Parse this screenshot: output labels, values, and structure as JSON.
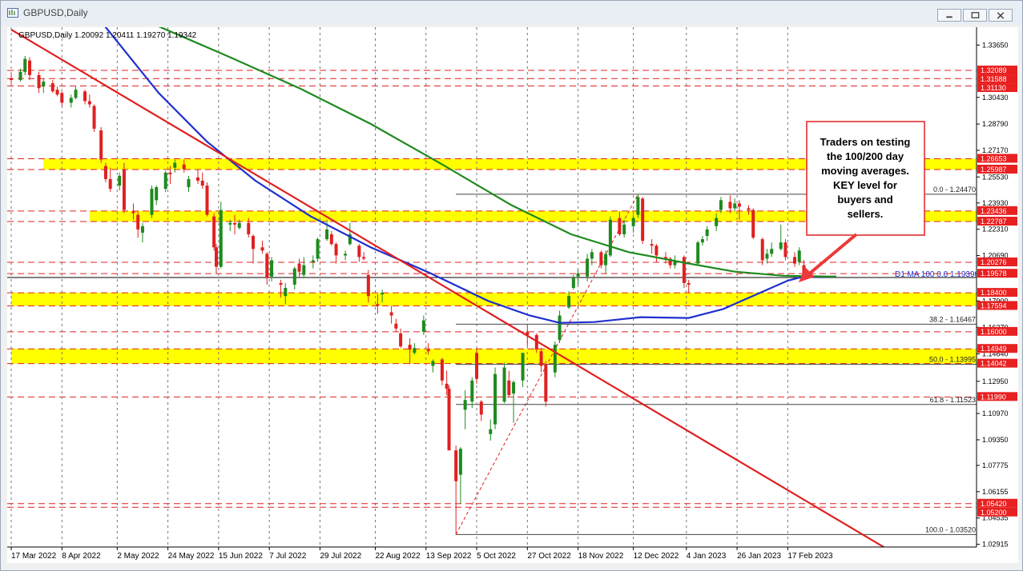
{
  "window": {
    "title": "GBPUSD,Daily",
    "buttons": [
      "minimize",
      "restore",
      "close"
    ]
  },
  "chart_data": {
    "type": "candlestick",
    "symbol_info": "GBPUSD,Daily  1.20092 1.20411 1.19270 1.19342",
    "symbol": "GBPUSD",
    "timeframe": "Daily",
    "ohlc_last": {
      "open": 1.20092,
      "high": 1.20411,
      "low": 1.1927,
      "close": 1.19342
    },
    "ylim": [
      1.0275,
      1.3475
    ],
    "y_ticks": [
      "1.33650",
      "1.30430",
      "1.28790",
      "1.27170",
      "1.25530",
      "1.23930",
      "1.22310",
      "1.20690",
      "1.19570",
      "1.17900",
      "1.16270",
      "1.14640",
      "1.12950",
      "1.10970",
      "1.09350",
      "1.07775",
      "1.06155",
      "1.04535",
      "1.02915"
    ],
    "x_dates": [
      "2022-03-17",
      "2023-02-28"
    ],
    "x_tick_labels": [
      {
        "label": "17 Mar 2022",
        "date": "2022-03-17"
      },
      {
        "label": "8 Apr 2022",
        "date": "2022-04-08"
      },
      {
        "label": "2 May 2022",
        "date": "2022-05-02"
      },
      {
        "label": "24 May 2022",
        "date": "2022-05-24"
      },
      {
        "label": "15 Jun 2022",
        "date": "2022-06-15"
      },
      {
        "label": "7 Jul 2022",
        "date": "2022-07-07"
      },
      {
        "label": "29 Jul 2022",
        "date": "2022-07-29"
      },
      {
        "label": "22 Aug 2022",
        "date": "2022-08-22"
      },
      {
        "label": "13 Sep 2022",
        "date": "2022-09-13"
      },
      {
        "label": "5 Oct 2022",
        "date": "2022-10-05"
      },
      {
        "label": "27 Oct 2022",
        "date": "2022-10-27"
      },
      {
        "label": "18 Nov 2022",
        "date": "2022-11-18"
      },
      {
        "label": "12 Dec 2022",
        "date": "2022-12-12"
      },
      {
        "label": "4 Jan 2023",
        "date": "2023-01-04"
      },
      {
        "label": "26 Jan 2023",
        "date": "2023-01-26"
      },
      {
        "label": "17 Feb 2023",
        "date": "2023-02-17"
      }
    ],
    "price_labels": [
      {
        "label": "1.32089",
        "value": 1.32089
      },
      {
        "label": "1.31588",
        "value": 1.31588
      },
      {
        "label": "1.31130",
        "value": 1.3113
      },
      {
        "label": "1.26653",
        "value": 1.26653
      },
      {
        "label": "1.25987",
        "value": 1.25987
      },
      {
        "label": "1.23436",
        "value": 1.23436
      },
      {
        "label": "1.22787",
        "value": 1.22787
      },
      {
        "label": "1.20276",
        "value": 1.20276
      },
      {
        "label": "1.19578",
        "value": 1.19578
      },
      {
        "label": "1.18400",
        "value": 1.184
      },
      {
        "label": "1.17594",
        "value": 1.17594
      },
      {
        "label": "1.16000",
        "value": 1.16
      },
      {
        "label": "1.14949",
        "value": 1.14949
      },
      {
        "label": "1.14042",
        "value": 1.14042
      },
      {
        "label": "1.11990",
        "value": 1.1199
      },
      {
        "label": "1.05420",
        "value": 1.0542
      },
      {
        "label": "1.05200",
        "value": 1.052
      }
    ],
    "yellow_zones": [
      {
        "from": 1.25987,
        "to": 1.26653,
        "x_start": "2022-03-31"
      },
      {
        "from": 1.22787,
        "to": 1.23436,
        "x_start": "2022-04-20"
      },
      {
        "from": 1.17594,
        "to": 1.184,
        "x_start": "2022-03-17"
      },
      {
        "from": 1.14042,
        "to": 1.14949,
        "x_start": "2022-03-17"
      }
    ],
    "red_dashed_levels": [
      1.32089,
      1.31588,
      1.3113,
      1.26653,
      1.25987,
      1.23436,
      1.22787,
      1.20276,
      1.19578,
      1.184,
      1.17594,
      1.16,
      1.14949,
      1.14042,
      1.1199,
      1.0542,
      1.052
    ],
    "fibonacci": {
      "low": {
        "value": 1.0352,
        "date": "2022-09-26"
      },
      "high": {
        "value": 1.2447,
        "date": "2022-12-14"
      },
      "levels": [
        {
          "label": "0.0 - 1.24470",
          "value": 1.2447
        },
        {
          "label": "38.2 - 1.16467",
          "value": 1.16467
        },
        {
          "label": "50.0 - 1.13995",
          "value": 1.13995
        },
        {
          "label": "61.8 - 1.11523",
          "value": 1.11523
        },
        {
          "label": "100.0 - 1.03520",
          "value": 1.0352
        }
      ]
    },
    "ma_label": "D1 MA 100 0.0  1.19390",
    "series": [
      {
        "name": "100 day MA",
        "color": "#1f2fcf",
        "points": [
          [
            "2022-04-25",
            1.351
          ],
          [
            "2022-05-20",
            1.307
          ],
          [
            "2022-06-10",
            1.277
          ],
          [
            "2022-07-01",
            1.253
          ],
          [
            "2022-07-25",
            1.231
          ],
          [
            "2022-08-20",
            1.212
          ],
          [
            "2022-09-15",
            1.196
          ],
          [
            "2022-10-10",
            1.179
          ],
          [
            "2022-10-28",
            1.17
          ],
          [
            "2022-11-10",
            1.1655
          ],
          [
            "2022-11-25",
            1.166
          ],
          [
            "2022-12-15",
            1.169
          ],
          [
            "2023-01-05",
            1.1685
          ],
          [
            "2023-01-20",
            1.174
          ],
          [
            "2023-02-05",
            1.184
          ],
          [
            "2023-02-17",
            1.1915
          ],
          [
            "2023-02-23",
            1.1937
          ],
          [
            "2023-03-10",
            1.194
          ]
        ]
      },
      {
        "name": "200 day MA",
        "color": "#1e8a1e",
        "points": [
          [
            "2022-05-20",
            1.348
          ],
          [
            "2022-06-20",
            1.329
          ],
          [
            "2022-07-20",
            1.31
          ],
          [
            "2022-08-20",
            1.288
          ],
          [
            "2022-09-20",
            1.263
          ],
          [
            "2022-10-20",
            1.238
          ],
          [
            "2022-11-15",
            1.22
          ],
          [
            "2022-12-10",
            1.209
          ],
          [
            "2023-01-05",
            1.202
          ],
          [
            "2023-01-25",
            1.197
          ],
          [
            "2023-02-15",
            1.1945
          ],
          [
            "2023-03-10",
            1.1939
          ]
        ]
      }
    ],
    "trendline": {
      "color": "#e02020",
      "from": {
        "date": "2022-03-17",
        "value": 1.346
      },
      "to": {
        "date": "2023-04-02",
        "value": 1.0255
      }
    },
    "current_price": 1.19342,
    "annotation": {
      "text": [
        "Traders on testing",
        "the 100/200 day",
        "moving averages.",
        "KEY  level for",
        "buyers and",
        "sellers."
      ]
    },
    "candles": [
      [
        "2022-03-17",
        1.316,
        1.319,
        1.312,
        1.315
      ],
      [
        "2022-03-21",
        1.315,
        1.322,
        1.314,
        1.32
      ],
      [
        "2022-03-23",
        1.32,
        1.3298,
        1.318,
        1.328
      ],
      [
        "2022-03-25",
        1.327,
        1.329,
        1.315,
        1.318
      ],
      [
        "2022-03-29",
        1.318,
        1.32,
        1.307,
        1.31
      ],
      [
        "2022-03-31",
        1.311,
        1.316,
        1.307,
        1.314
      ],
      [
        "2022-04-04",
        1.313,
        1.315,
        1.307,
        1.308
      ],
      [
        "2022-04-06",
        1.309,
        1.311,
        1.305,
        1.306
      ],
      [
        "2022-04-08",
        1.307,
        1.308,
        1.299,
        1.301
      ],
      [
        "2022-04-12",
        1.301,
        1.306,
        1.298,
        1.304
      ],
      [
        "2022-04-14",
        1.304,
        1.311,
        1.303,
        1.309
      ],
      [
        "2022-04-18",
        1.308,
        1.309,
        1.3,
        1.302
      ],
      [
        "2022-04-20",
        1.302,
        1.306,
        1.298,
        1.3
      ],
      [
        "2022-04-22",
        1.299,
        1.3,
        1.283,
        1.285
      ],
      [
        "2022-04-25",
        1.284,
        1.286,
        1.264,
        1.266
      ],
      [
        "2022-04-27",
        1.262,
        1.264,
        1.252,
        1.254
      ],
      [
        "2022-04-29",
        1.254,
        1.261,
        1.246,
        1.248
      ],
      [
        "2022-05-03",
        1.25,
        1.258,
        1.247,
        1.256
      ],
      [
        "2022-05-05",
        1.26,
        1.264,
        1.233,
        1.235
      ],
      [
        "2022-05-09",
        1.234,
        1.239,
        1.229,
        1.233
      ],
      [
        "2022-05-11",
        1.232,
        1.234,
        1.218,
        1.223
      ],
      [
        "2022-05-13",
        1.221,
        1.227,
        1.215,
        1.225
      ],
      [
        "2022-05-17",
        1.232,
        1.25,
        1.23,
        1.248
      ],
      [
        "2022-05-19",
        1.241,
        1.25,
        1.238,
        1.249
      ],
      [
        "2022-05-23",
        1.248,
        1.259,
        1.246,
        1.258
      ],
      [
        "2022-05-25",
        1.258,
        1.262,
        1.251,
        1.257
      ],
      [
        "2022-05-27",
        1.261,
        1.266,
        1.258,
        1.264
      ],
      [
        "2022-05-31",
        1.263,
        1.266,
        1.258,
        1.26
      ],
      [
        "2022-06-02",
        1.249,
        1.256,
        1.246,
        1.254
      ],
      [
        "2022-06-06",
        1.255,
        1.26,
        1.251,
        1.253
      ],
      [
        "2022-06-08",
        1.253,
        1.258,
        1.248,
        1.25
      ],
      [
        "2022-06-10",
        1.25,
        1.252,
        1.231,
        1.232
      ],
      [
        "2022-06-13",
        1.231,
        1.233,
        1.21,
        1.212
      ],
      [
        "2022-06-14",
        1.212,
        1.214,
        1.196,
        1.2
      ],
      [
        "2022-06-16",
        1.2,
        1.24,
        1.199,
        1.235
      ],
      [
        "2022-06-20",
        1.226,
        1.229,
        1.222,
        1.227
      ],
      [
        "2022-06-22",
        1.227,
        1.232,
        1.22,
        1.226
      ],
      [
        "2022-06-24",
        1.224,
        1.229,
        1.223,
        1.227
      ],
      [
        "2022-06-28",
        1.227,
        1.23,
        1.218,
        1.22
      ],
      [
        "2022-06-30",
        1.219,
        1.22,
        1.202,
        1.211
      ],
      [
        "2022-07-04",
        1.212,
        1.216,
        1.208,
        1.21
      ],
      [
        "2022-07-06",
        1.208,
        1.209,
        1.189,
        1.193
      ],
      [
        "2022-07-08",
        1.194,
        1.206,
        1.191,
        1.204
      ],
      [
        "2022-07-12",
        1.19,
        1.192,
        1.181,
        1.189
      ],
      [
        "2022-07-14",
        1.182,
        1.19,
        1.177,
        1.187
      ],
      [
        "2022-07-18",
        1.189,
        1.2,
        1.186,
        1.199
      ],
      [
        "2022-07-20",
        1.202,
        1.205,
        1.194,
        1.197
      ],
      [
        "2022-07-22",
        1.195,
        1.206,
        1.193,
        1.201
      ],
      [
        "2022-07-26",
        1.203,
        1.207,
        1.199,
        1.204
      ],
      [
        "2022-07-28",
        1.205,
        1.218,
        1.203,
        1.217
      ],
      [
        "2022-08-01",
        1.217,
        1.229,
        1.216,
        1.223
      ],
      [
        "2022-08-03",
        1.22,
        1.222,
        1.213,
        1.214
      ],
      [
        "2022-08-05",
        1.214,
        1.215,
        1.202,
        1.207
      ],
      [
        "2022-08-09",
        1.207,
        1.21,
        1.204,
        1.208
      ],
      [
        "2022-08-11",
        1.214,
        1.227,
        1.213,
        1.22
      ],
      [
        "2022-08-15",
        1.213,
        1.214,
        1.203,
        1.206
      ],
      [
        "2022-08-17",
        1.206,
        1.209,
        1.204,
        1.205
      ],
      [
        "2022-08-19",
        1.195,
        1.198,
        1.178,
        1.182
      ],
      [
        "2022-08-23",
        1.177,
        1.183,
        1.171,
        1.176
      ],
      [
        "2022-08-25",
        1.183,
        1.186,
        1.178,
        1.184
      ],
      [
        "2022-08-29",
        1.172,
        1.176,
        1.165,
        1.17
      ],
      [
        "2022-08-31",
        1.165,
        1.168,
        1.16,
        1.162
      ],
      [
        "2022-09-02",
        1.159,
        1.162,
        1.15,
        1.151
      ],
      [
        "2022-09-06",
        1.152,
        1.156,
        1.14,
        1.149
      ],
      [
        "2022-09-08",
        1.147,
        1.153,
        1.146,
        1.15
      ],
      [
        "2022-09-12",
        1.16,
        1.17,
        1.158,
        1.167
      ],
      [
        "2022-09-14",
        1.149,
        1.153,
        1.146,
        1.148
      ],
      [
        "2022-09-16",
        1.139,
        1.143,
        1.135,
        1.142
      ],
      [
        "2022-09-20",
        1.143,
        1.144,
        1.127,
        1.13
      ],
      [
        "2022-09-22",
        1.128,
        1.136,
        1.121,
        1.125
      ],
      [
        "2022-09-23",
        1.125,
        1.127,
        1.087,
        1.087
      ],
      [
        "2022-09-26",
        1.087,
        1.09,
        1.0352,
        1.068
      ],
      [
        "2022-09-28",
        1.072,
        1.089,
        1.054,
        1.088
      ],
      [
        "2022-09-30",
        1.112,
        1.124,
        1.1,
        1.118
      ],
      [
        "2022-10-03",
        1.117,
        1.132,
        1.113,
        1.13
      ],
      [
        "2022-10-05",
        1.147,
        1.15,
        1.128,
        1.131
      ],
      [
        "2022-10-07",
        1.117,
        1.118,
        1.105,
        1.109
      ],
      [
        "2022-10-11",
        1.097,
        1.106,
        1.093,
        1.1
      ],
      [
        "2022-10-13",
        1.103,
        1.138,
        1.1,
        1.134
      ],
      [
        "2022-10-17",
        1.117,
        1.141,
        1.116,
        1.138
      ],
      [
        "2022-10-19",
        1.13,
        1.136,
        1.12,
        1.121
      ],
      [
        "2022-10-21",
        1.122,
        1.13,
        1.104,
        1.129
      ],
      [
        "2022-10-25",
        1.13,
        1.147,
        1.126,
        1.147
      ],
      [
        "2022-10-27",
        1.16,
        1.164,
        1.151,
        1.158
      ],
      [
        "2022-10-31",
        1.158,
        1.159,
        1.147,
        1.149
      ],
      [
        "2022-11-02",
        1.148,
        1.15,
        1.135,
        1.139
      ],
      [
        "2022-11-04",
        1.14,
        1.142,
        1.114,
        1.117
      ],
      [
        "2022-11-08",
        1.135,
        1.154,
        1.132,
        1.152
      ],
      [
        "2022-11-10",
        1.155,
        1.173,
        1.153,
        1.17
      ],
      [
        "2022-11-14",
        1.175,
        1.185,
        1.174,
        1.182
      ],
      [
        "2022-11-16",
        1.187,
        1.195,
        1.186,
        1.193
      ],
      [
        "2022-11-18",
        1.194,
        1.198,
        1.189,
        1.196
      ],
      [
        "2022-11-22",
        1.194,
        1.208,
        1.191,
        1.205
      ],
      [
        "2022-11-24",
        1.205,
        1.211,
        1.201,
        1.209
      ],
      [
        "2022-11-28",
        1.209,
        1.21,
        1.199,
        1.201
      ],
      [
        "2022-11-30",
        1.201,
        1.21,
        1.196,
        1.208
      ],
      [
        "2022-12-02",
        1.207,
        1.231,
        1.206,
        1.229
      ],
      [
        "2022-12-06",
        1.23,
        1.234,
        1.219,
        1.22
      ],
      [
        "2022-12-08",
        1.22,
        1.229,
        1.218,
        1.226
      ],
      [
        "2022-12-12",
        1.225,
        1.232,
        1.221,
        1.23
      ],
      [
        "2022-12-14",
        1.232,
        1.2447,
        1.23,
        1.243
      ],
      [
        "2022-12-16",
        1.242,
        1.243,
        1.214,
        1.216
      ],
      [
        "2022-12-20",
        1.214,
        1.217,
        1.208,
        1.213
      ],
      [
        "2022-12-22",
        1.213,
        1.214,
        1.203,
        1.207
      ],
      [
        "2022-12-26",
        1.206,
        1.209,
        1.202,
        1.205
      ],
      [
        "2022-12-28",
        1.205,
        1.206,
        1.199,
        1.201
      ],
      [
        "2022-12-30",
        1.201,
        1.207,
        1.199,
        1.204
      ],
      [
        "2023-01-03",
        1.206,
        1.207,
        1.187,
        1.19
      ],
      [
        "2023-01-05",
        1.19,
        1.192,
        1.184,
        1.189
      ],
      [
        "2023-01-09",
        1.202,
        1.216,
        1.201,
        1.215
      ],
      [
        "2023-01-11",
        1.215,
        1.219,
        1.213,
        1.217
      ],
      [
        "2023-01-13",
        1.219,
        1.225,
        1.216,
        1.223
      ],
      [
        "2023-01-17",
        1.225,
        1.233,
        1.222,
        1.23
      ],
      [
        "2023-01-19",
        1.235,
        1.243,
        1.233,
        1.241
      ],
      [
        "2023-01-23",
        1.24,
        1.244,
        1.233,
        1.236
      ],
      [
        "2023-01-25",
        1.236,
        1.242,
        1.234,
        1.239
      ],
      [
        "2023-01-27",
        1.239,
        1.241,
        1.229,
        1.237
      ],
      [
        "2023-01-31",
        1.236,
        1.238,
        1.232,
        1.235
      ],
      [
        "2023-02-02",
        1.235,
        1.236,
        1.217,
        1.218
      ],
      [
        "2023-02-06",
        1.217,
        1.218,
        1.201,
        1.204
      ],
      [
        "2023-02-08",
        1.205,
        1.211,
        1.202,
        1.208
      ],
      [
        "2023-02-10",
        1.208,
        1.215,
        1.206,
        1.211
      ],
      [
        "2023-02-14",
        1.211,
        1.226,
        1.21,
        1.215
      ],
      [
        "2023-02-16",
        1.215,
        1.217,
        1.204,
        1.206
      ],
      [
        "2023-02-20",
        1.206,
        1.209,
        1.2,
        1.202
      ],
      [
        "2023-02-22",
        1.203,
        1.212,
        1.201,
        1.21
      ],
      [
        "2023-02-24",
        1.201,
        1.2041,
        1.1927,
        1.1934
      ]
    ]
  }
}
